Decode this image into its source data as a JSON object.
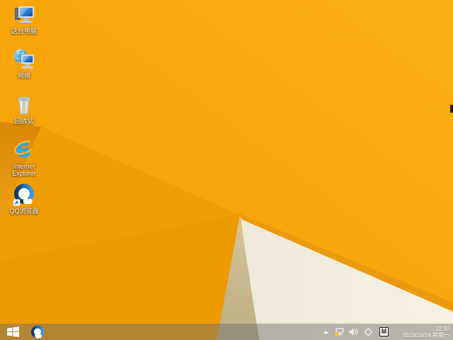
{
  "desktop": {
    "icons": [
      {
        "name": "this-pc",
        "label": "这台电脑"
      },
      {
        "name": "network",
        "label": "网络"
      },
      {
        "name": "recycle-bin",
        "label": "回收站"
      },
      {
        "name": "internet-explorer",
        "label": "Internet Explorer"
      },
      {
        "name": "qq-browser",
        "label": "QQ浏览器"
      }
    ]
  },
  "taskbar": {
    "start": {
      "icon": "windows-logo"
    },
    "pinned_apps": [
      {
        "name": "qq-browser",
        "icon": "qq-browser-logo"
      }
    ],
    "tray": {
      "hidden_icons_button": "chevron-up-icon",
      "icons": [
        "network-warning-icon",
        "speaker-icon",
        "target-ring-icon",
        "ime-mode-box"
      ],
      "ime_indicator": "M"
    },
    "clock": {
      "time": "12:30",
      "date": "2019/10/14 星期一"
    }
  },
  "wallpaper_colors": {
    "base_orange": "#F8A509",
    "bright_orange": "#FCAE14",
    "facet_orange": "#F09C04",
    "dark_wedge": "#DB8A04",
    "cream": "#F4EFE0",
    "tan_sliver": "#C9B88D",
    "amber_edge": "#EB9A10"
  },
  "ui_colors": {
    "taskbar_tint": "rgba(110,108,108,0.46)",
    "desktop_label_text": "#FFFFFF",
    "clock_text": "#FBFBF8"
  }
}
